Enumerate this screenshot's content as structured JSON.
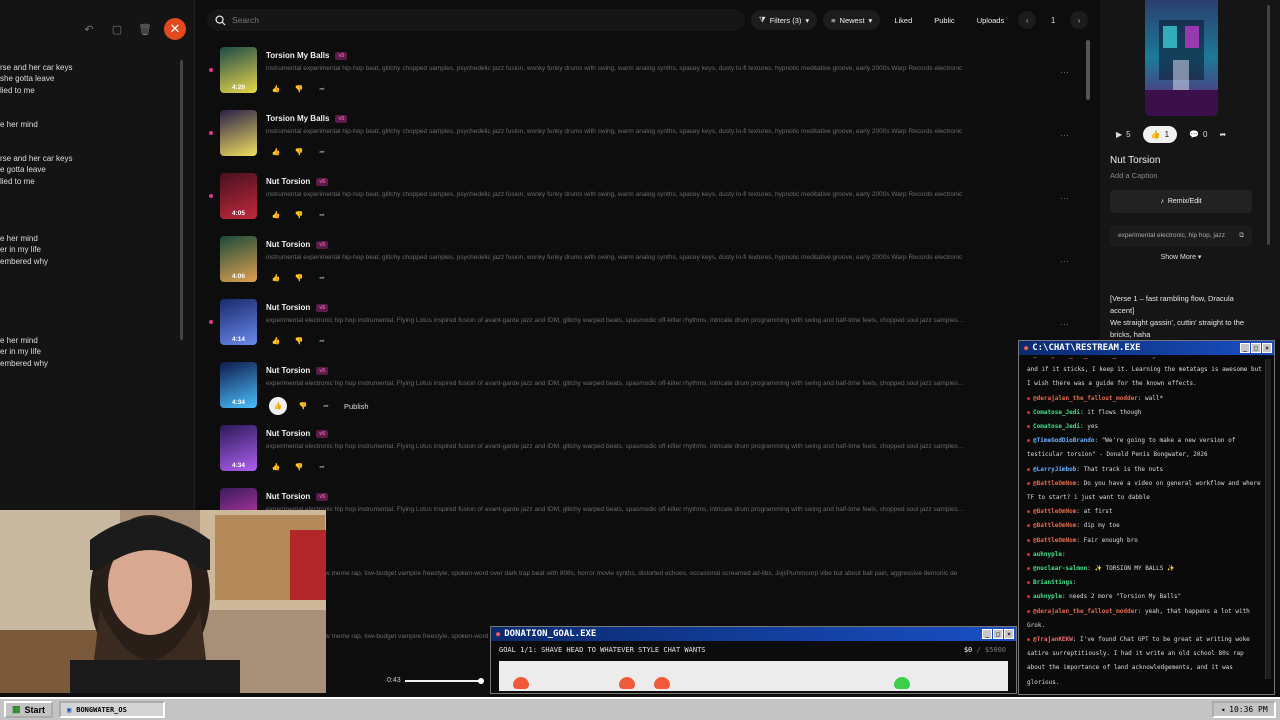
{
  "lyrics_panel": {
    "lines": [
      "rse and her car keys",
      "she gotta leave",
      "lied to me",
      "e her mind",
      "rse and her car keys",
      "e gotta leave",
      "lied to me",
      "e her mind",
      "er in my life",
      "embered why",
      "e her mind",
      "er in my life",
      "embered why"
    ]
  },
  "toolbar": {
    "search_placeholder": "Search",
    "filters_label": "Filters (3)",
    "sort_label": "Newest",
    "liked_label": "Liked",
    "public_label": "Public",
    "uploads_label": "Uploads",
    "page": "1"
  },
  "tracks": [
    {
      "title": "Torsion My Balls",
      "badge": "v5",
      "duration": "4:20",
      "tags": "instrumental experimental hip-hop beat, glitchy chopped samples, psychedelic jazz fusion, wonky funky drums with swing, warm analog synths, spacey keys, dusty lo-fi textures, hypnotic meditative groove, early 2000s Warp Records electronic"
    },
    {
      "title": "Torsion My Balls",
      "badge": "v5",
      "duration": "",
      "tags": "instrumental experimental hip-hop beat, glitchy chopped samples, psychedelic jazz fusion, wonky funky drums with swing, warm analog synths, spacey keys, dusty lo-fi textures, hypnotic meditative groove, early 2000s Warp Records electronic"
    },
    {
      "title": "Nut Torsion",
      "badge": "v5",
      "duration": "4:05",
      "tags": "instrumental experimental hip-hop beat, glitchy chopped samples, psychedelic jazz fusion, wonky funky drums with swing, warm analog synths, spacey keys, dusty lo-fi textures, hypnotic meditative groove, early 2000s Warp Records electronic"
    },
    {
      "title": "Nut Torsion",
      "badge": "v5",
      "duration": "4:06",
      "tags": "instrumental experimental hip-hop beat, glitchy chopped samples, psychedelic jazz fusion, wonky funky drums with swing, warm analog synths, spacey keys, dusty lo-fi textures, hypnotic meditative groove, early 2000s Warp Records electronic"
    },
    {
      "title": "Nut Torsion",
      "badge": "v5",
      "duration": "4:14",
      "tags": "experimental electronic hip hop instrumental, Flying Lotus inspired fusion of avant-garde jazz and IDM, glitchy warped beats, spasmodic off-kilter rhythms, intricate drum programming with swing and half-time feels, chopped soul jazz samples, c..."
    },
    {
      "title": "Nut Torsion",
      "badge": "v5",
      "duration": "4:34",
      "tags": "experimental electronic hip hop instrumental, Flying Lotus inspired fusion of avant-garde jazz and IDM, glitchy warped beats, spasmodic off-kilter rhythms, intricate drum programming with swing and half-time feels, chopped soul jazz samples, c...",
      "publish": "Publish"
    },
    {
      "title": "Nut Torsion",
      "badge": "v5",
      "duration": "4:34",
      "tags": "experimental electronic hip hop instrumental, Flying Lotus inspired fusion of avant-garde jazz and IDM, glitchy warped beats, spasmodic off-kilter rhythms, intricate drum programming with swing and half-time feels, chopped soul jazz samples, c..."
    },
    {
      "title": "Nut Torsion",
      "badge": "v5",
      "duration": "",
      "tags": "experimental electronic hip hop instrumental, Flying Lotus inspired fusion of avant-garde jazz and IDM, glitchy warped beats, spasmodic off-kilter rhythms, intricate drum programming with swing and half-time feels, chopped soul jazz samples, c..."
    }
  ],
  "hidden_rows": [
    "w meme rap, low-budget vampire freestyle, spoken-word over dark trap beat with 808s, horror movie synths, distorted echoes, occasional screamed ad-libs, Joji/Pummcorp vibe but about ball pain, aggressive demonic de",
    "w meme rap, low-budget vampire freestyle, spoken-word"
  ],
  "right_panel": {
    "plays": "5",
    "likes": "1",
    "comments": "0",
    "title": "Nut Torsion",
    "caption": "Add a Caption",
    "remix_label": "Remix/Edit",
    "tags": "experimental electronic, hip hop, jazz",
    "show_more": "Show More",
    "lyrics": "[Verse 1 – fast rambling flow, Dracula accent]\nWe straight gassin', cuttin' straight to the bricks, haha"
  },
  "chat": {
    "title": "C:\\CHAT\\RESTREAM.EXE",
    "messages": [
      {
        "user": "@derajalen_the_fallout_modder",
        "text": "i just throw shit at the wall and if it sticks, I keep it. Learning the metatags is awesome but I wish there was a guide for the known effects.",
        "color": "u1"
      },
      {
        "user": "@derajalen_the_fallout_modder",
        "text": "wall*",
        "color": "u1"
      },
      {
        "user": "Comatose_Jedi",
        "text": "it flows though",
        "color": "u2"
      },
      {
        "user": "Comatose_Jedi",
        "text": "yes",
        "color": "u2"
      },
      {
        "user": "@TimeGodDioBrando",
        "text": "\"We're going to make a new version of testicular torsion\" - Donald Penis Bongwater, 2026",
        "color": "u3"
      },
      {
        "user": "@LarryJimbob",
        "text": "That track is the nuts",
        "color": "u3"
      },
      {
        "user": "@BattleOmNom",
        "text": "Do you have a video on general workflow and where TF to start? i just want to dabble",
        "color": "u1"
      },
      {
        "user": "@BattleOmNom",
        "text": "at first",
        "color": "u1"
      },
      {
        "user": "@BattleOmNom",
        "text": "dip my toe",
        "color": "u1"
      },
      {
        "user": "@BattleOmNom",
        "text": "Fair enough bro",
        "color": "u1"
      },
      {
        "user": "auhnyple",
        "text": "",
        "color": "u2"
      },
      {
        "user": "@nuclear-salmon",
        "text": "✨ TORSION MY BALLS ✨",
        "color": "u2"
      },
      {
        "user": "BrianStings",
        "text": "",
        "color": "u2"
      },
      {
        "user": "auhnyple",
        "text": "needs 2 more \"Torsion My Balls\"",
        "color": "u2"
      },
      {
        "user": "@derajalen_the_fallout_modder",
        "text": "yeah, that happens a lot with Grok.",
        "color": "u1"
      },
      {
        "user": "@TrajanKEKW",
        "text": "I've found Chat GPT to be great at writing woke satire surreptitiously. I had it write an old school 80s rap about the importance of land acknowledgements, and it was glorious.",
        "color": "u4"
      }
    ]
  },
  "donation": {
    "title": "DONATION_GOAL.EXE",
    "goal": "GOAL 1/1: SHAVE HEAD TO WHATEVER STYLE CHAT WANTS",
    "current": "$0",
    "max": "$5000"
  },
  "player": {
    "time": "0:43",
    "progress": 0.95
  },
  "taskbar": {
    "start_label": "Start",
    "app_label": "BONGWATER_OS",
    "clock": "10:36 PM"
  },
  "colors": {
    "accent_pink": "#d63a86",
    "close_orange": "#e2491f",
    "title_bar_blue": "#1a4fc4"
  }
}
